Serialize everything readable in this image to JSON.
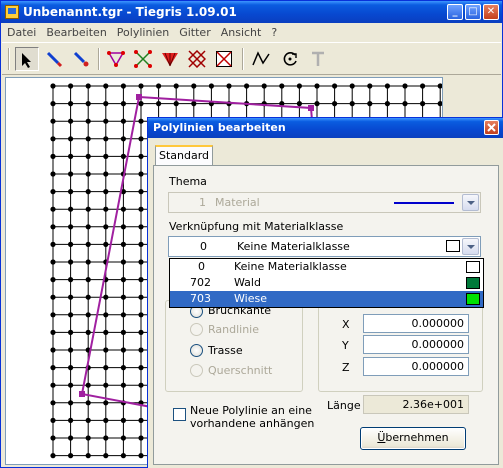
{
  "window": {
    "title": "Unbenannt.tgr - Tiegris 1.09.01",
    "minimize_glyph": "_",
    "maximize_glyph": "□",
    "close_glyph": "✕"
  },
  "menu": [
    "Datei",
    "Bearbeiten",
    "Polylinien",
    "Gitter",
    "Ansicht",
    "?"
  ],
  "toolbar_icons": [
    "arrow-select-icon",
    "pen-icon",
    "pen-dot-icon",
    "triangle-net-icon",
    "cross-points-icon",
    "red-fan-icon",
    "cross-grid-icon",
    "box-cross-icon",
    "polyline-icon",
    "rotate-icon",
    "text-icon"
  ],
  "colors": {
    "polyline": "#a020a0",
    "grid": "#000000",
    "wald": "#007a3a",
    "wiese": "#00e000",
    "selection": "#316ac5",
    "thema_line": "#0000cc"
  },
  "dialog": {
    "title": "Polylinien bearbeiten",
    "tab": "Standard",
    "thema_label": "Thema",
    "thema_value": {
      "num": "1",
      "name": "Material"
    },
    "verknuepfung_label": "Verknüpfung mit Materialklasse",
    "material_selected": {
      "num": "0",
      "name": "Keine Materialklasse"
    },
    "material_options": [
      {
        "num": "0",
        "name": "Keine Materialklasse",
        "color": "#ffffff"
      },
      {
        "num": "702",
        "name": "Wald",
        "color": "#007a3a"
      },
      {
        "num": "703",
        "name": "Wiese",
        "color": "#00e000"
      }
    ],
    "radios": [
      {
        "label": "Bruchkante",
        "enabled": true
      },
      {
        "label": "Randlinie",
        "enabled": false
      },
      {
        "label": "Trasse",
        "enabled": true
      },
      {
        "label": "Querschnitt",
        "enabled": false
      }
    ],
    "coords": [
      {
        "axis": "X",
        "value": "0.000000"
      },
      {
        "axis": "Y",
        "value": "0.000000"
      },
      {
        "axis": "Z",
        "value": "0.000000"
      }
    ],
    "laenge_label": "Länge",
    "laenge_value": "2.36e+001",
    "append_checkbox_label_1": "Neue Polylinie an eine",
    "append_checkbox_label_2": "vorhandene anhängen",
    "button_accel": "Ü",
    "button_rest": "bernehmen"
  }
}
